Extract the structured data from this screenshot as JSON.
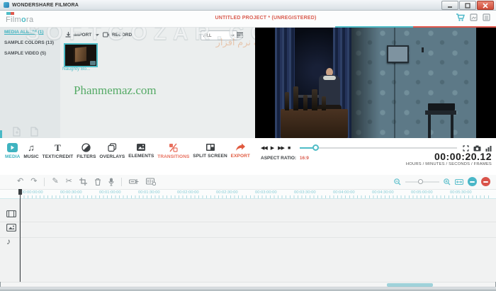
{
  "window": {
    "title": "WONDERSHARE FILMORA"
  },
  "header": {
    "logo_film": "Film",
    "logo_o": "o",
    "logo_ra": "ra",
    "project_title": "UNTITLED PROJECT * (UNREGISTERED)"
  },
  "media_panel": {
    "tabs": [
      {
        "label": "MEDIA ALBUM (1)"
      },
      {
        "label": "SAMPLE COLORS (13)"
      },
      {
        "label": "SAMPLE VIDEO (5)"
      }
    ],
    "import_label": "IMPORT",
    "record_label": "RECORD",
    "filter_value": "ALL",
    "clip_name": "Naughty Bo...",
    "watermark_ghost": "SOFTGOZAR.COM",
    "watermark_fa": "اولین دانشنامه نرم افزار",
    "watermark_site": "Phanmemaz.com"
  },
  "preview": {
    "aspect_ratio_label": "ASPECT RATIO:",
    "aspect_ratio_value": "16:9",
    "timecode": "00:00:20.12",
    "timecode_units": "HOURS / MINUTES / SECONDS / FRAMES"
  },
  "toolbar": {
    "items": [
      {
        "label": "MEDIA"
      },
      {
        "label": "MUSIC"
      },
      {
        "label": "TEXT/CREDIT"
      },
      {
        "label": "FILTERS"
      },
      {
        "label": "OVERLAYS"
      },
      {
        "label": "ELEMENTS"
      },
      {
        "label": "TRANSITIONS"
      },
      {
        "label": "SPLIT SCREEN"
      },
      {
        "label": "EXPORT"
      }
    ]
  },
  "timeline": {
    "ruler_labels": [
      "00:00:00:00",
      "00:00:30:00",
      "00:01:00:00",
      "00:01:30:00",
      "00:02:00:00",
      "00:02:30:00",
      "00:03:00:00",
      "00:03:30:00",
      "00:04:00:00",
      "00:04:30:00",
      "00:05:00:00",
      "00:05:30:00"
    ]
  },
  "colors": {
    "accent_teal": "#4fbcc6",
    "accent_red": "#e0584d"
  }
}
